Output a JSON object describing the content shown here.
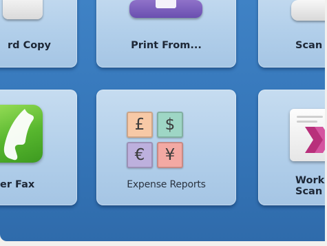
{
  "tiles": {
    "copy": {
      "label": "rd Copy",
      "icon": "copy-icon"
    },
    "print_from": {
      "label": "Print From...",
      "icon": "print-icon"
    },
    "scan": {
      "label": "Scan",
      "icon": "scan-icon"
    },
    "fax": {
      "label": "er Fax",
      "icon": "phone-fax-icon"
    },
    "expense_reports": {
      "label": "Expense Reports",
      "icon": "currency-icon",
      "currency_symbols": [
        "£",
        "$",
        "€",
        "¥"
      ],
      "currency_colors": [
        "#f7c9a6",
        "#9ed6c5",
        "#bdb0dd",
        "#f3a9a3"
      ]
    },
    "workflow_scan": {
      "label_line1": "Work",
      "label_line2": "Scan",
      "icon": "workflow-icon"
    }
  },
  "colors": {
    "background": "#3a7cc0",
    "tile": "#b5d1eb",
    "label_text": "#1d2736"
  }
}
